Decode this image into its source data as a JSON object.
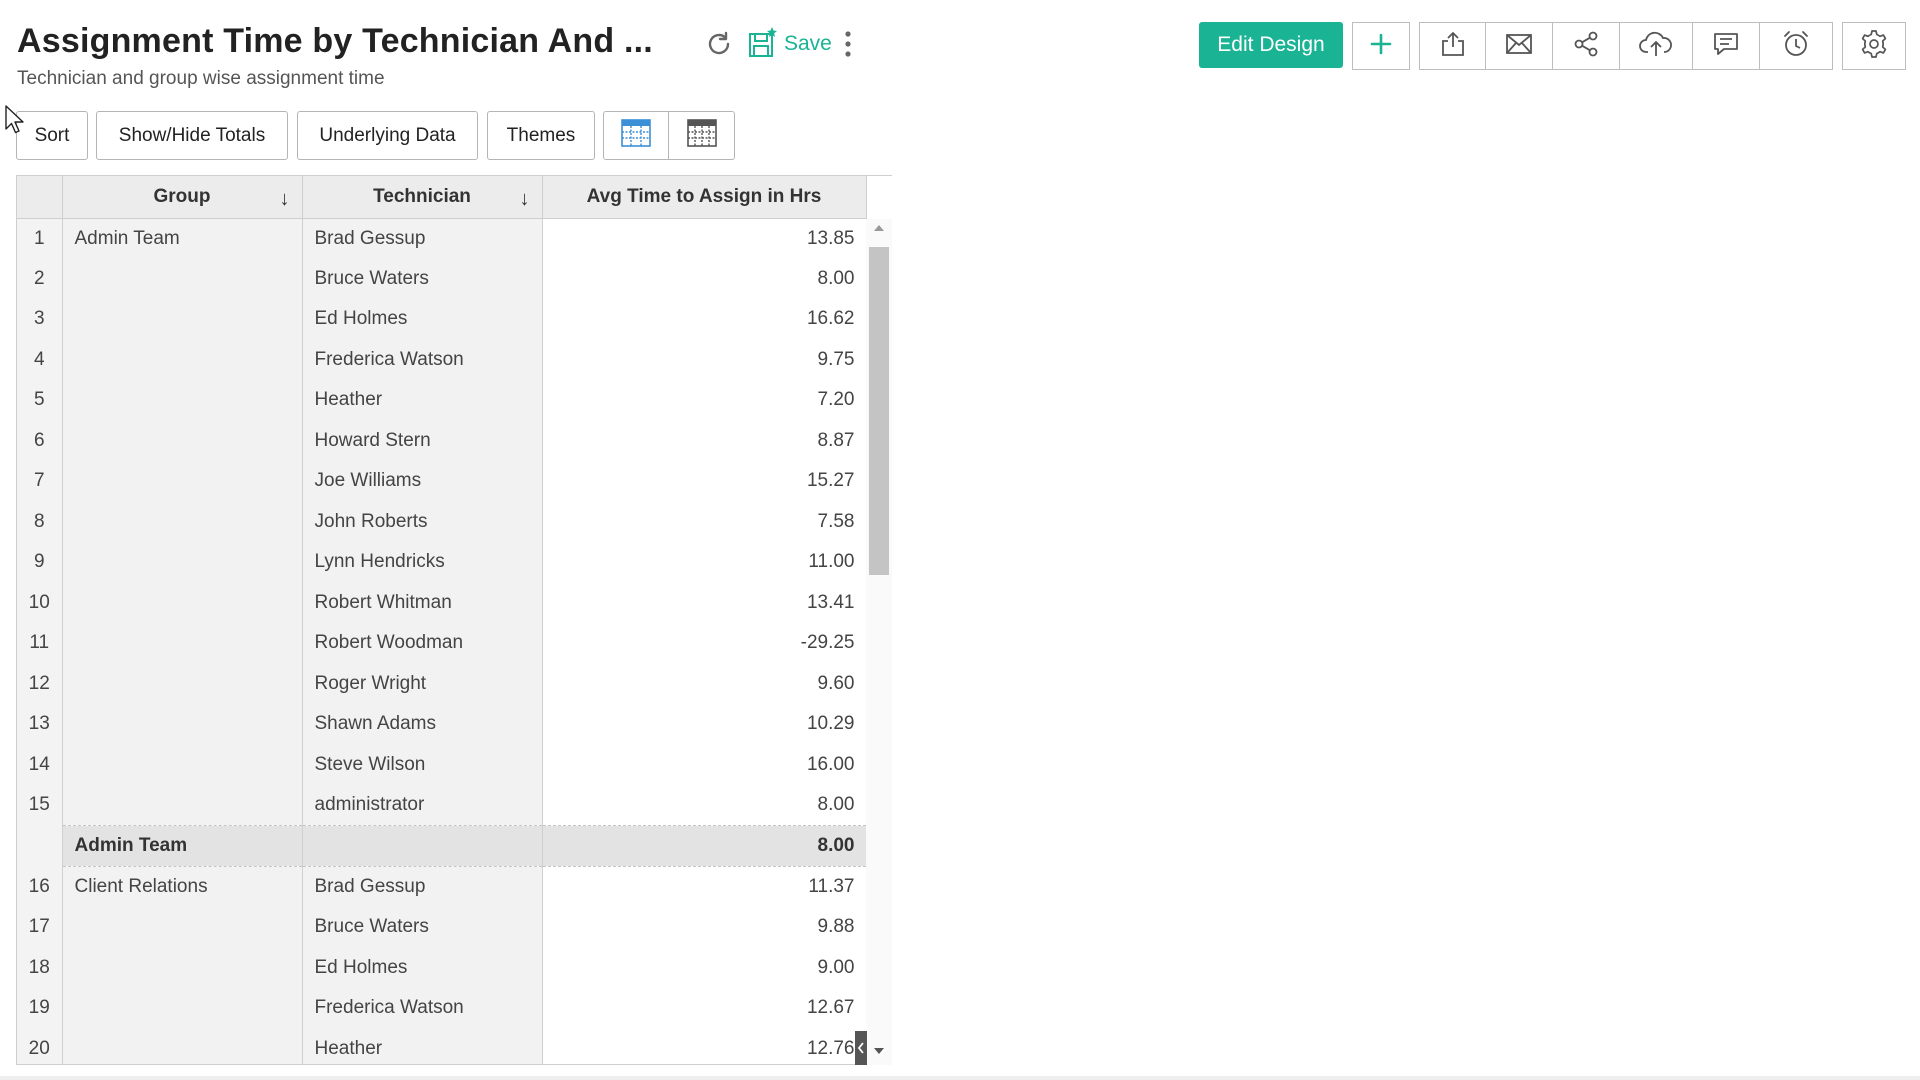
{
  "header": {
    "title": "Assignment Time by Technician And ...",
    "subtitle": "Technician and group wise assignment time",
    "save_label": "Save",
    "edit_design_label": "Edit Design"
  },
  "toolbar": {
    "sort_label": "Sort",
    "show_hide_totals_label": "Show/Hide Totals",
    "underlying_data_label": "Underlying Data",
    "themes_label": "Themes"
  },
  "colors": {
    "accent": "#1ab394",
    "header_bg": "#ececec",
    "subtotal_bg": "#e3e3e3"
  },
  "icons": [
    "refresh-icon",
    "save-icon",
    "kebab-icon",
    "add-icon",
    "export-icon",
    "email-icon",
    "share-icon",
    "publish-icon",
    "comment-icon",
    "schedule-icon",
    "settings-icon",
    "table-view-icon",
    "pivot-view-icon"
  ],
  "table": {
    "columns": [
      "Group",
      "Technician",
      "Avg Time to Assign in Hrs"
    ],
    "rows": [
      {
        "num": "1",
        "group": "Admin Team",
        "tech": "Brad Gessup",
        "value": "13.85"
      },
      {
        "num": "2",
        "group": "",
        "tech": "Bruce Waters",
        "value": "8.00"
      },
      {
        "num": "3",
        "group": "",
        "tech": "Ed Holmes",
        "value": "16.62"
      },
      {
        "num": "4",
        "group": "",
        "tech": "Frederica Watson",
        "value": "9.75"
      },
      {
        "num": "5",
        "group": "",
        "tech": "Heather",
        "value": "7.20"
      },
      {
        "num": "6",
        "group": "",
        "tech": "Howard Stern",
        "value": "8.87"
      },
      {
        "num": "7",
        "group": "",
        "tech": "Joe Williams",
        "value": "15.27"
      },
      {
        "num": "8",
        "group": "",
        "tech": "John Roberts",
        "value": "7.58"
      },
      {
        "num": "9",
        "group": "",
        "tech": "Lynn Hendricks",
        "value": "11.00"
      },
      {
        "num": "10",
        "group": "",
        "tech": "Robert Whitman",
        "value": "13.41"
      },
      {
        "num": "11",
        "group": "",
        "tech": "Robert Woodman",
        "value": "-29.25"
      },
      {
        "num": "12",
        "group": "",
        "tech": "Roger Wright",
        "value": "9.60"
      },
      {
        "num": "13",
        "group": "",
        "tech": "Shawn Adams",
        "value": "10.29"
      },
      {
        "num": "14",
        "group": "",
        "tech": "Steve Wilson",
        "value": "16.00"
      },
      {
        "num": "15",
        "group": "",
        "tech": "administrator",
        "value": "8.00"
      },
      {
        "subtotal": true,
        "num": "",
        "group": "Admin Team",
        "tech": "",
        "value": "8.00"
      },
      {
        "num": "16",
        "group": "Client Relations",
        "tech": "Brad Gessup",
        "value": "11.37"
      },
      {
        "num": "17",
        "group": "",
        "tech": "Bruce Waters",
        "value": "9.88"
      },
      {
        "num": "18",
        "group": "",
        "tech": "Ed Holmes",
        "value": "9.00"
      },
      {
        "num": "19",
        "group": "",
        "tech": "Frederica Watson",
        "value": "12.67"
      },
      {
        "num": "20",
        "group": "",
        "tech": "Heather",
        "value": "12.76"
      }
    ]
  }
}
